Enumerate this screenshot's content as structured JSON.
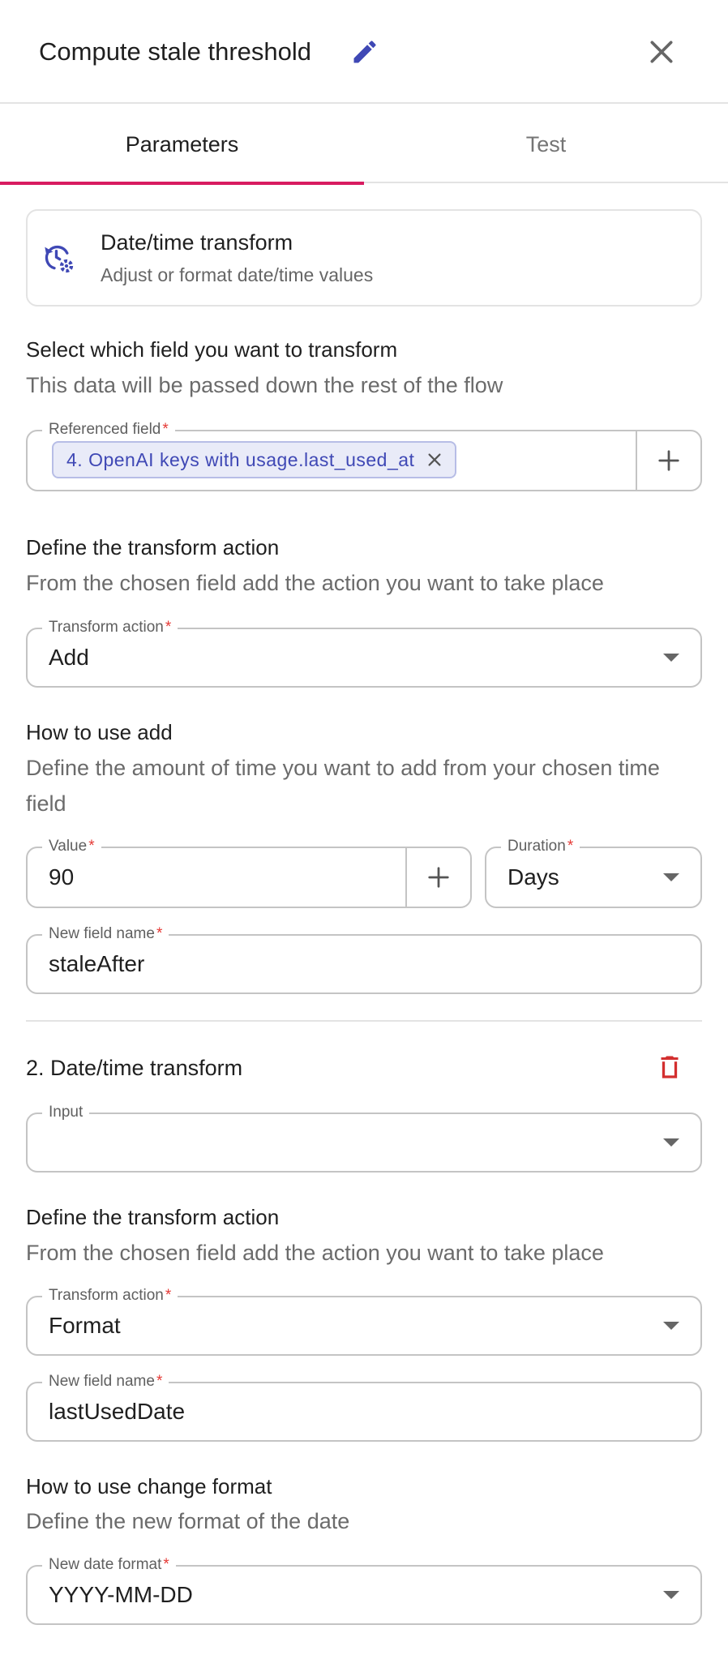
{
  "header": {
    "title": "Compute stale threshold"
  },
  "tabs": [
    {
      "label": "Parameters",
      "active": true
    },
    {
      "label": "Test",
      "active": false
    }
  ],
  "card": {
    "title": "Date/time transform",
    "subtitle": "Adjust or format date/time values"
  },
  "select_field": {
    "title": "Select which field you want to transform",
    "desc": "This data will be passed down the rest of the flow",
    "referenced_label": "Referenced field",
    "chip": "4. OpenAI keys with usage.last_used_at"
  },
  "transform1": {
    "title": "Define the transform action",
    "desc": "From the chosen field add the action you want to take place",
    "action_label": "Transform action",
    "action_value": "Add"
  },
  "howto_add": {
    "title": "How to use add",
    "desc": "Define the amount of time you want to add from your chosen time field",
    "value_label": "Value",
    "value": "90",
    "duration_label": "Duration",
    "duration_value": "Days",
    "newfield_label": "New field name",
    "newfield_value": "staleAfter"
  },
  "transform2": {
    "title": "2. Date/time transform",
    "input_label": "Input",
    "input_value": "",
    "action_title": "Define the transform action",
    "action_desc": "From the chosen field add the action you want to take place",
    "action_label": "Transform action",
    "action_value": "Format",
    "newfield_label": "New field name",
    "newfield_value": "lastUsedDate"
  },
  "howto_format": {
    "title": "How to use change format",
    "desc": "Define the new format of the date",
    "format_label": "New date format",
    "format_value": "YYYY-MM-DD"
  },
  "required_mark": "*",
  "colors": {
    "accent": "#d81b60",
    "primary": "#3f48b5",
    "danger": "#d32f2f",
    "required": "#e53935"
  }
}
